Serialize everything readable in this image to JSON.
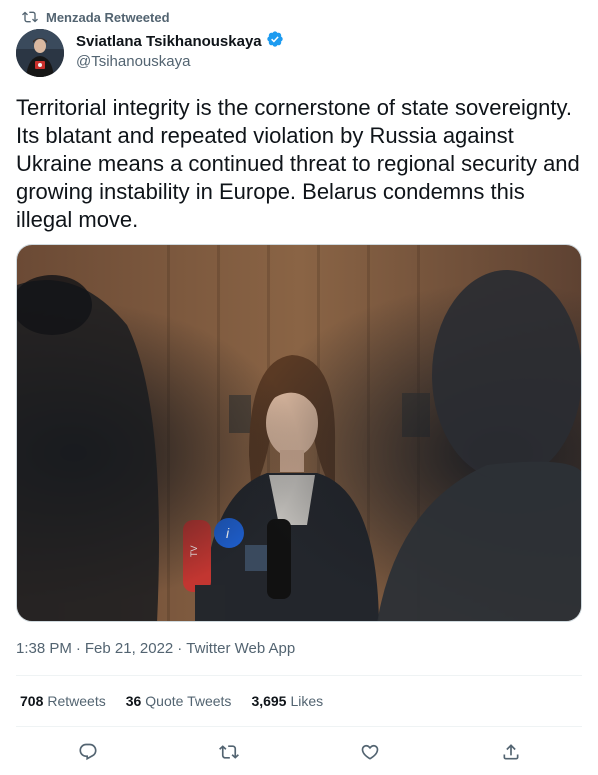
{
  "retweet_context": {
    "icon": "retweet-icon",
    "text": "Menzada Retweeted"
  },
  "author": {
    "name": "Sviatlana Tsikhanouskaya",
    "handle": "@Tsihanouskaya",
    "verified": true
  },
  "tweet": {
    "text": "Territorial integrity is the cornerstone of state sovereignty. Its blatant and repeated violation by Russia against Ukraine means a continued threat to regional security and growing instability in Europe. Belarus condemns this illegal move."
  },
  "media": {
    "type": "photo"
  },
  "meta": {
    "time": "1:38 PM",
    "separator_1": "·",
    "date": "Feb 21, 2022",
    "separator_2": "·",
    "source": "Twitter Web App"
  },
  "stats": {
    "retweets_count": "708",
    "retweets_label": "Retweets",
    "quotes_count": "36",
    "quotes_label": "Quote Tweets",
    "likes_count": "3,695",
    "likes_label": "Likes"
  },
  "actions": [
    {
      "name": "reply",
      "icon": "reply-icon"
    },
    {
      "name": "retweet",
      "icon": "retweet-icon"
    },
    {
      "name": "like",
      "icon": "heart-icon"
    },
    {
      "name": "share",
      "icon": "share-icon"
    }
  ],
  "colors": {
    "text_primary": "#0f1419",
    "text_secondary": "#536471",
    "verified_blue": "#1d9bf0",
    "divider": "#eff3f4"
  }
}
